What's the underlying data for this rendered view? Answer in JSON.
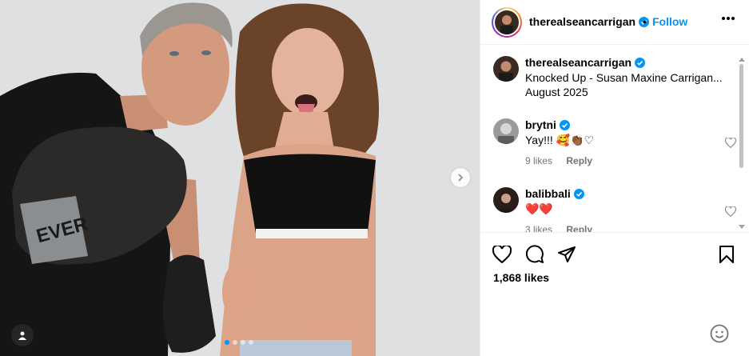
{
  "post": {
    "author": "therealseancarrigan",
    "separator": "•",
    "follow_label": "Follow",
    "caption": "Knocked Up - Susan Maxine Carrigan...",
    "caption_date": "August 2025",
    "likes": "1,868 likes",
    "slide_count": 4,
    "active_slide": 1
  },
  "comments": [
    {
      "user": "brytni",
      "text": "Yay!!! 🥰👏🏾♡",
      "likes": "9 likes",
      "reply": "Reply"
    },
    {
      "user": "balibbali",
      "text": "❤️❤️",
      "likes": "3 likes",
      "reply": "Reply"
    }
  ],
  "icons": {
    "verified": "verified-badge-icon",
    "more": "more-options-icon",
    "like": "heart-icon",
    "comment": "comment-icon",
    "share": "paper-plane-icon",
    "save": "bookmark-icon",
    "emoji": "emoji-icon",
    "tag": "user-tag-icon",
    "next": "chevron-right-icon"
  },
  "colors": {
    "accent": "#0095f6",
    "muted": "#737373",
    "divider": "#efefef"
  }
}
